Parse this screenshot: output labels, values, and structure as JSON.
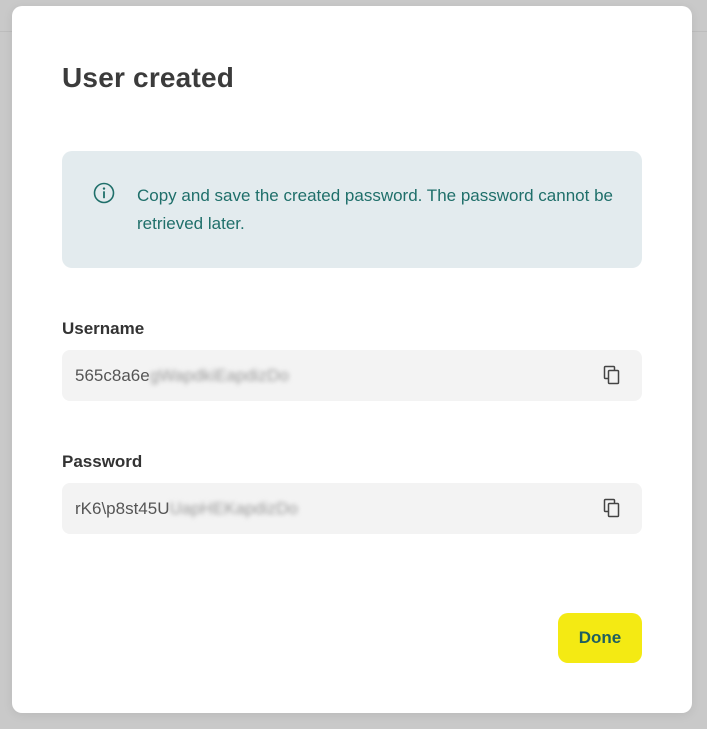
{
  "dialog": {
    "title": "User created",
    "info": {
      "icon": "info-circle-icon",
      "text": "Copy and save the created password. The password cannot be retrieved later."
    },
    "fields": {
      "username": {
        "label": "Username",
        "value_visible": "565c8a6e",
        "value_obscured": "gWapdkiEapdizDo",
        "copy_icon": "copy-icon"
      },
      "password": {
        "label": "Password",
        "value_visible": "rK6\\p8st45U",
        "value_obscured": "UapHEKapdizDo",
        "copy_icon": "copy-icon"
      }
    },
    "done_label": "Done"
  },
  "colors": {
    "overlay": "#c9c9c9",
    "modal_bg": "#ffffff",
    "info_bg": "#e3ebee",
    "info_text": "#1f6f6a",
    "field_bg": "#f3f3f3",
    "primary_button": "#f4ea13",
    "primary_button_text": "#1f5f5f"
  }
}
